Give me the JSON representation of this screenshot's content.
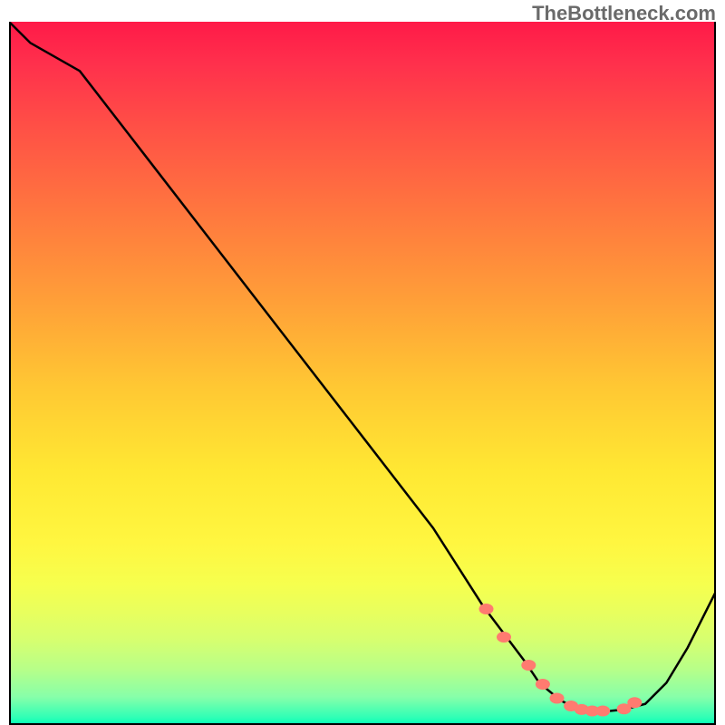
{
  "watermark": "TheBottleneck.com",
  "chart_data": {
    "type": "line",
    "title": "",
    "xlabel": "",
    "ylabel": "",
    "xlim": [
      0,
      100
    ],
    "ylim": [
      0,
      100
    ],
    "curve": {
      "x": [
        0,
        3,
        10,
        20,
        30,
        40,
        50,
        60,
        67,
        70,
        73,
        75,
        78,
        80,
        82,
        84,
        85,
        87,
        90,
        93,
        96,
        100
      ],
      "y": [
        100,
        97,
        93,
        80,
        67,
        54,
        41,
        28,
        17,
        13,
        9,
        6,
        3.5,
        2.5,
        2,
        2,
        2,
        2.2,
        3,
        6,
        11,
        19
      ]
    },
    "markers": {
      "x": [
        67.5,
        70,
        73.5,
        75.5,
        77.5,
        79.5,
        81,
        82.5,
        84,
        87,
        88.5
      ],
      "y": [
        16.5,
        12.5,
        8.5,
        5.8,
        3.8,
        2.7,
        2.2,
        2.0,
        2.0,
        2.3,
        3.2
      ]
    },
    "gradient_colors": {
      "top": "#ff1a48",
      "mid": "#fff640",
      "bottom": "#00ffb4"
    }
  }
}
